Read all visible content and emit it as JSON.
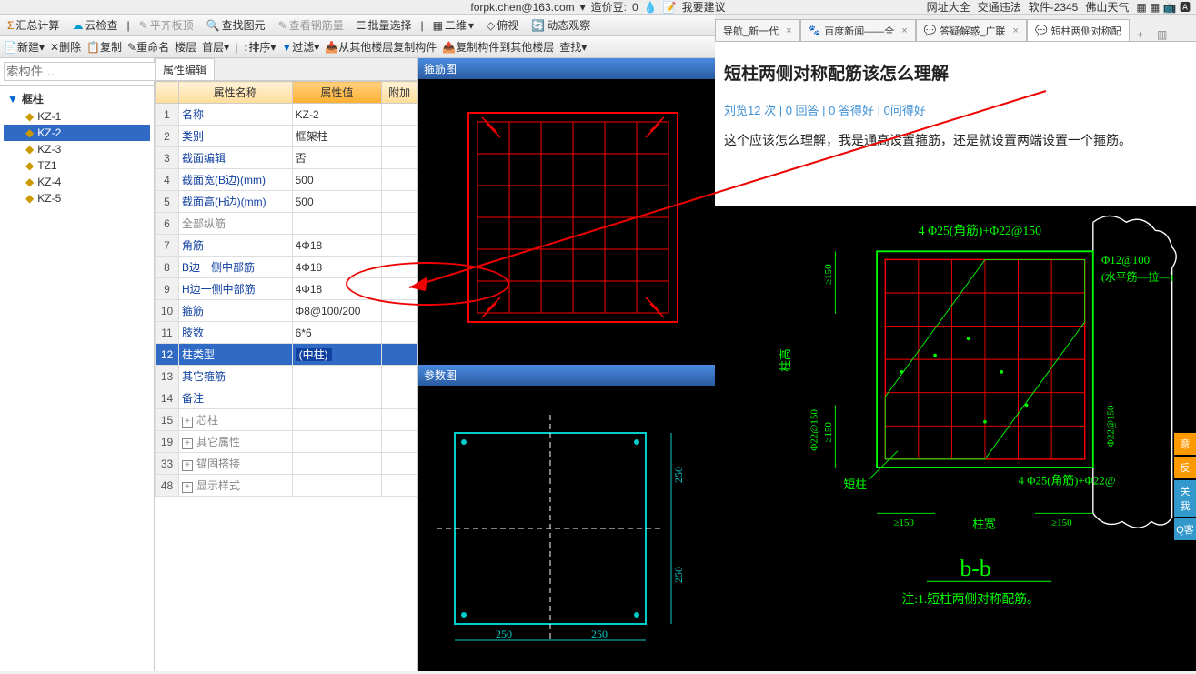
{
  "top": {
    "email": "forpk.chen@163.com",
    "beans_label": "造价豆:",
    "beans": "0",
    "suggest": "我要建议",
    "links": [
      "网址大全",
      "交通违法",
      "软件-2345",
      "佛山天气"
    ]
  },
  "browser_tabs": [
    {
      "label": "导航_新一代",
      "active": false
    },
    {
      "label": "百度新闻——全",
      "active": false
    },
    {
      "label": "答疑解惑_广联",
      "active": false
    },
    {
      "label": "短柱两侧对称配",
      "active": true
    }
  ],
  "toolbar": [
    "汇总计算",
    "云检查",
    "平齐板顶",
    "查找图元",
    "查看钢筋量",
    "批量选择",
    "二维",
    "俯视",
    "动态观察"
  ],
  "toolbar2": [
    "新建",
    "删除",
    "复制",
    "重命名",
    "楼层",
    "首层",
    "排序",
    "过滤",
    "从其他楼层复制构件",
    "复制构件到其他楼层",
    "查找"
  ],
  "left": {
    "search_placeholder": "索构件…",
    "root": "框柱",
    "items": [
      "KZ-1",
      "KZ-2",
      "KZ-3",
      "TZ1",
      "KZ-4",
      "KZ-5"
    ],
    "selected": "KZ-2"
  },
  "prop": {
    "tab": "属性编辑",
    "cols": {
      "name": "属性名称",
      "value": "属性值",
      "extra": "附加"
    },
    "rows": [
      {
        "n": "1",
        "name": "名称",
        "val": "KZ-2"
      },
      {
        "n": "2",
        "name": "类别",
        "val": "框架柱"
      },
      {
        "n": "3",
        "name": "截面编辑",
        "val": "否"
      },
      {
        "n": "4",
        "name": "截面宽(B边)(mm)",
        "val": "500"
      },
      {
        "n": "5",
        "name": "截面高(H边)(mm)",
        "val": "500"
      },
      {
        "n": "6",
        "name": "全部纵筋",
        "val": "",
        "gray": true
      },
      {
        "n": "7",
        "name": "角筋",
        "val": "4Φ18"
      },
      {
        "n": "8",
        "name": "B边一侧中部筋",
        "val": "4Φ18"
      },
      {
        "n": "9",
        "name": "H边一侧中部筋",
        "val": "4Φ18"
      },
      {
        "n": "10",
        "name": "箍筋",
        "val": "Φ8@100/200"
      },
      {
        "n": "11",
        "name": "肢数",
        "val": "6*6"
      },
      {
        "n": "12",
        "name": "柱类型",
        "val": "(中柱)",
        "sel": true
      },
      {
        "n": "13",
        "name": "其它箍筋",
        "val": ""
      },
      {
        "n": "14",
        "name": "备注",
        "val": ""
      },
      {
        "n": "15",
        "name": "芯柱",
        "val": "",
        "exp": true,
        "gray": true
      },
      {
        "n": "19",
        "name": "其它属性",
        "val": "",
        "exp": true,
        "gray": true
      },
      {
        "n": "33",
        "name": "锚固搭接",
        "val": "",
        "exp": true,
        "gray": true
      },
      {
        "n": "48",
        "name": "显示样式",
        "val": "",
        "exp": true,
        "gray": true
      }
    ]
  },
  "cad": {
    "t1": "箍筋图",
    "t2": "参数图",
    "dim": "250"
  },
  "web": {
    "title": "短柱两侧对称配筋该怎么理解",
    "meta": {
      "views": "刘览12 次",
      "answers": "0 回答",
      "good": "0 答得好",
      "bad": "0问得好"
    },
    "body": "这个应该怎么理解，我是通高设置箍筋，还是就设置两端设置一个箍筋。"
  },
  "cad2": {
    "top_label": "4 Φ25(角筋)+Φ22@150",
    "right_label1": "Φ12@100",
    "right_label2": "(水平筋—拉—)",
    "bottom_label": "4 Φ25(角筋)+Φ22@",
    "left_label": "柱高",
    "short_col": "短柱",
    "dim150": "≥150",
    "col_width": "柱宽",
    "section": "b-b",
    "note": "注:1.短柱两侧对称配筋。",
    "stirrup": "Φ22@150"
  },
  "side_widgets": [
    "意",
    "反",
    "关我",
    "Q客"
  ]
}
